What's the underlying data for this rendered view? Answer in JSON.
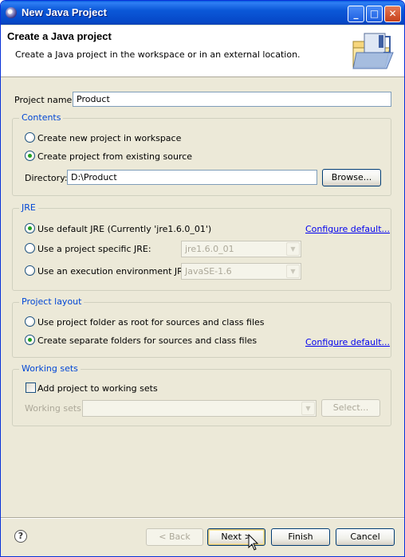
{
  "window": {
    "title": "New Java Project",
    "controls": {
      "minimize": "_",
      "maximize": "□",
      "close": "✕"
    }
  },
  "header": {
    "title": "Create a Java project",
    "description": "Create a Java project in the workspace or in an external location."
  },
  "project_name": {
    "label": "Project name:",
    "value": "Product"
  },
  "contents": {
    "title": "Contents",
    "options": [
      {
        "label": "Create new project in workspace",
        "checked": false
      },
      {
        "label": "Create project from existing source",
        "checked": true
      }
    ],
    "directory_label": "Directory:",
    "directory_value": "D:\\Product",
    "browse_label": "Browse..."
  },
  "jre": {
    "title": "JRE",
    "options": [
      {
        "label": "Use default JRE (Currently 'jre1.6.0_01')",
        "checked": true
      },
      {
        "label": "Use a project specific JRE:",
        "checked": false,
        "select_value": "jre1.6.0_01"
      },
      {
        "label": "Use an execution environment JRE:",
        "checked": false,
        "select_value": "JavaSE-1.6"
      }
    ],
    "configure_label": "Configure default..."
  },
  "project_layout": {
    "title": "Project layout",
    "options": [
      {
        "label": "Use project folder as root for sources and class files",
        "checked": false
      },
      {
        "label": "Create separate folders for sources and class files",
        "checked": true
      }
    ],
    "configure_label": "Configure default..."
  },
  "working_sets": {
    "title": "Working sets",
    "add_label": "Add project to working sets",
    "add_checked": false,
    "sets_label": "Working sets:",
    "select_label": "Select..."
  },
  "footer": {
    "help": "?",
    "back": "< Back",
    "next": "Next >",
    "finish": "Finish",
    "cancel": "Cancel"
  },
  "colors": {
    "titlebar": "#0648c8",
    "dialog_bg": "#ece9d8",
    "group_title": "#0046d5",
    "link": "#0000ee",
    "radio_dot": "#21a121"
  }
}
